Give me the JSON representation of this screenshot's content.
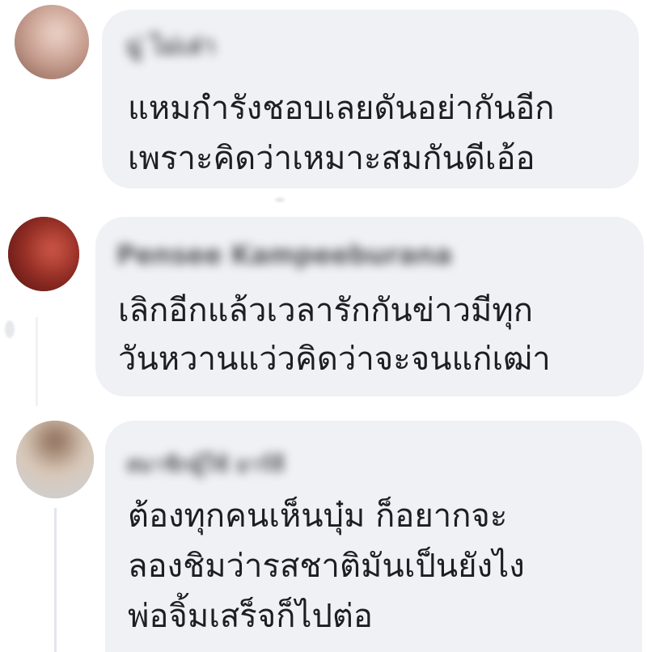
{
  "comments": [
    {
      "author": "มู่ ไม่เล่า",
      "lines": [
        "แหมกำรังชอบเลยดันอย่ากันอีก",
        "เพราะคิดว่าเหมาะสมกันดีเอ้อ"
      ]
    },
    {
      "author": "Pensee Kampeeburana",
      "lines": [
        "เลิกอีกแล้วเวลารักกันข่าวมีทุก",
        "วันหวานแว่วคิดว่าจะจนแก่เฒ่า"
      ]
    },
    {
      "author": "สมาชิกผู้ใช้ อาร์ลี",
      "lines": [
        "ต้องทุกคนเห็นบุ๋ม ก็อยากจะ",
        "ลองชิมว่ารสชาติมันเป็นยังไง",
        "พ่อจิ้มเสร็จก็ไปต่อ"
      ]
    }
  ],
  "colors": {
    "bubble": "#eff1f4",
    "text": "#1c1e21",
    "author": "#3a3b3c",
    "avatar1": "#b89a90",
    "avatar2": "#8a2a22",
    "avatar3": "#c7b5a6"
  },
  "icons": [
    "avatar",
    "avatar",
    "avatar"
  ]
}
